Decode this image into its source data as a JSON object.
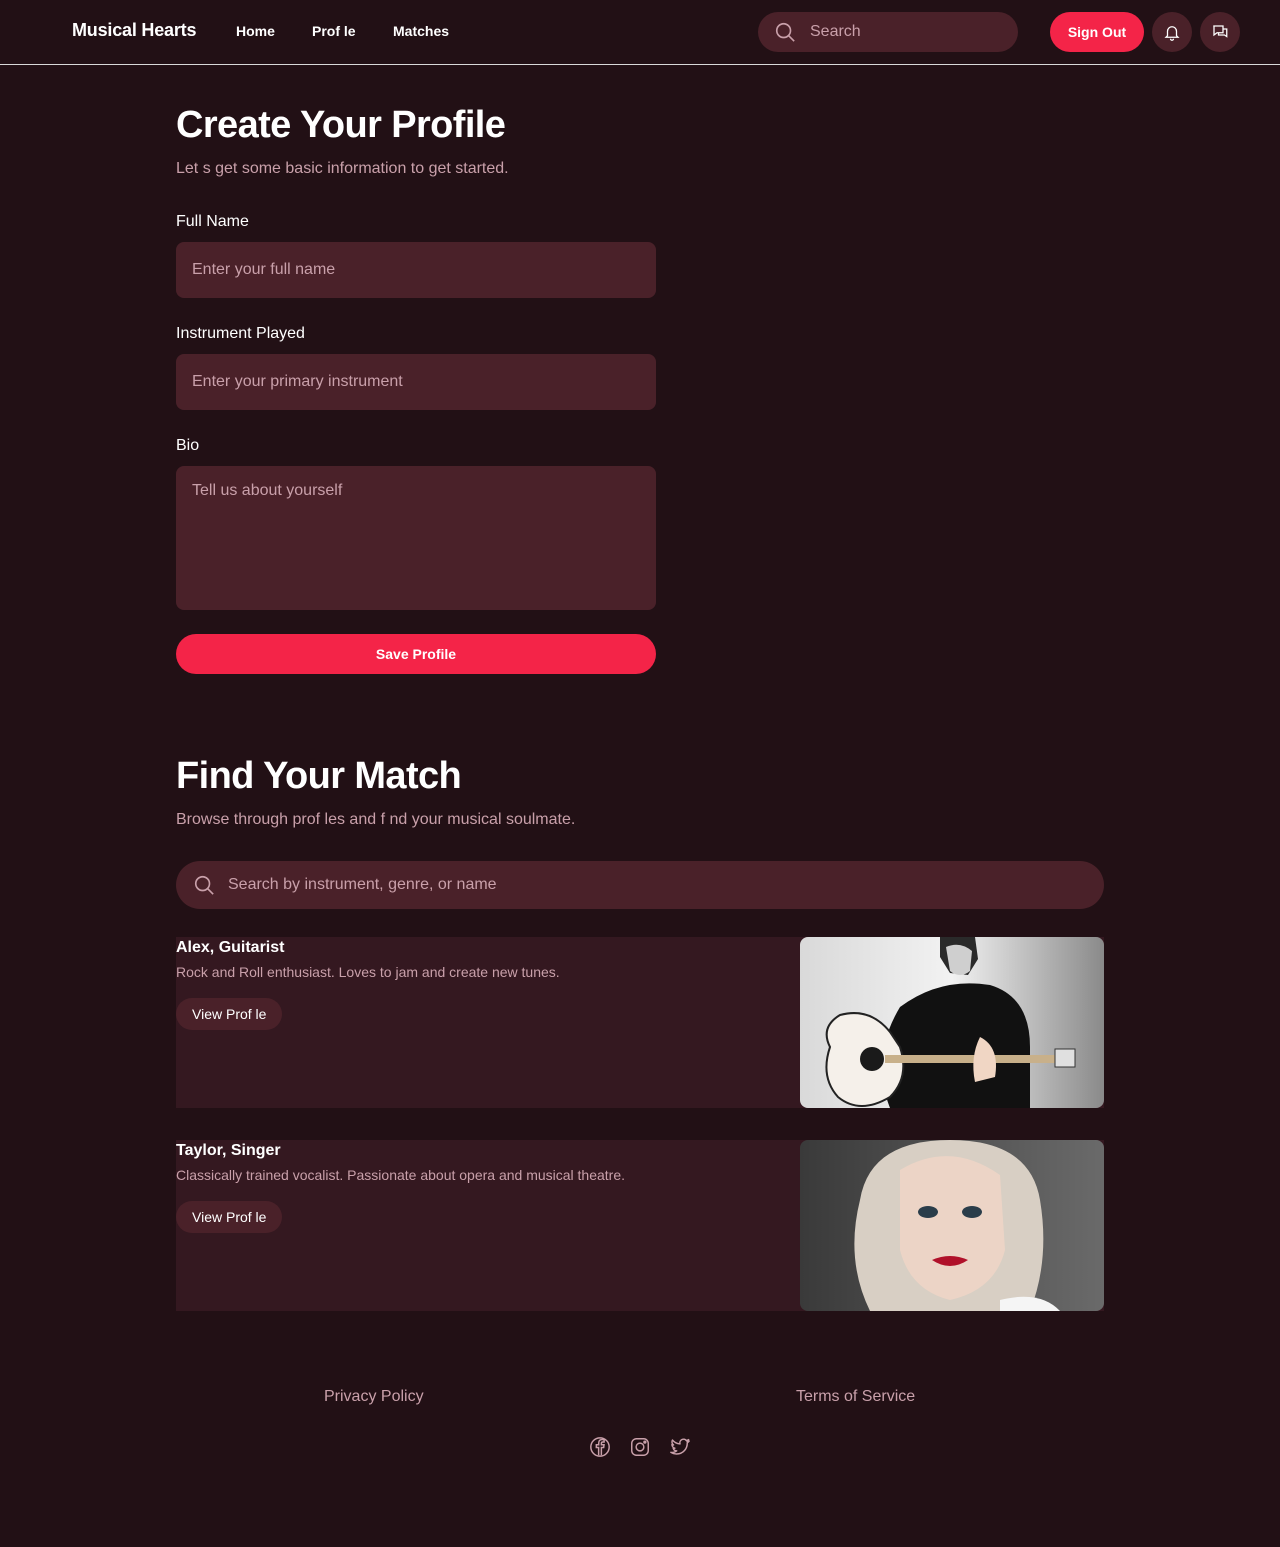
{
  "header": {
    "brand": "Musical Hearts",
    "nav": [
      "Home",
      "Prof le",
      "Matches"
    ],
    "search_placeholder": "Search",
    "sign_out": "Sign Out",
    "icons": [
      "bell-icon",
      "chat-icon"
    ]
  },
  "profile_form": {
    "title": "Create Your Profile",
    "subtitle": "Let s get some basic information to get started.",
    "full_name_label": "Full Name",
    "full_name_placeholder": "Enter your full name",
    "instrument_label": "Instrument Played",
    "instrument_placeholder": "Enter your primary instrument",
    "bio_label": "Bio",
    "bio_placeholder": "Tell us about yourself",
    "save_label": "Save Profile"
  },
  "matches": {
    "title": "Find Your Match",
    "subtitle": "Browse through prof les and f nd your musical soulmate.",
    "search_placeholder": "Search by instrument, genre, or name",
    "cards": [
      {
        "name": "Alex, Guitarist",
        "description": "Rock and Roll enthusiast. Loves to jam and create new tunes.",
        "button": "View Prof le",
        "photo": "guitarist-photo"
      },
      {
        "name": "Taylor, Singer",
        "description": "Classically trained vocalist. Passionate about opera and musical theatre.",
        "button": "View Prof le",
        "photo": "singer-photo"
      }
    ]
  },
  "footer": {
    "links": [
      "Privacy Policy",
      "Terms of Service"
    ],
    "social": [
      "facebook-icon",
      "instagram-icon",
      "twitter-icon"
    ]
  },
  "colors": {
    "background": "#221015",
    "surface": "#4a2129",
    "card": "#341820",
    "accent": "#f42448",
    "muted_text": "#c9a0aa"
  }
}
